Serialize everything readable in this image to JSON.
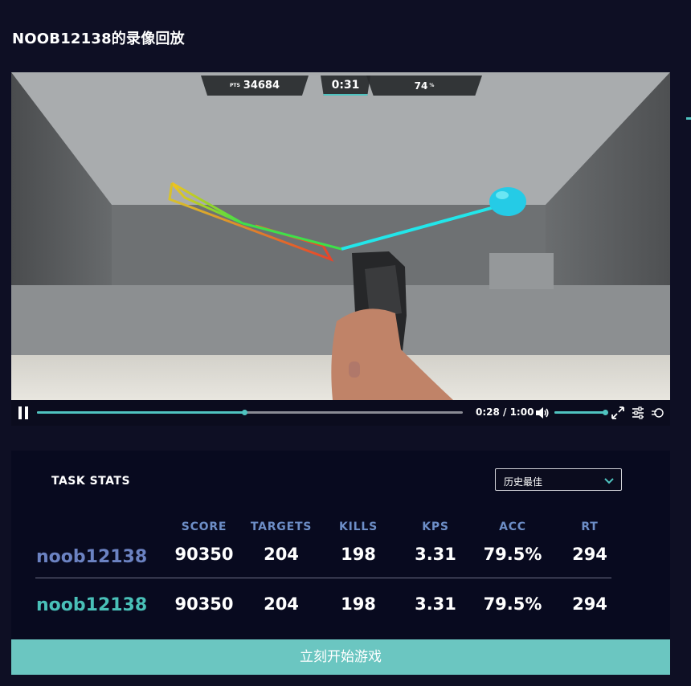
{
  "page": {
    "title": "NOOB12138的录像回放"
  },
  "hud": {
    "pts_label": "PTS",
    "points": "34684",
    "timer": "0:31",
    "accuracy": "74",
    "accuracy_unit": "%"
  },
  "player": {
    "time_text": "0:28 / 1:00",
    "progress": 0.486,
    "volume": 0.95,
    "icons": [
      "pause-icon",
      "volume-icon",
      "fullscreen-icon",
      "settings-sliders-icon",
      "mode-icon"
    ],
    "accent_color": "#4fc3c0"
  },
  "stats": {
    "title": "TASK STATS",
    "filter": {
      "selected": "历史最佳"
    },
    "columns": [
      "SCORE",
      "TARGETS",
      "KILLS",
      "KPS",
      "ACC",
      "RT"
    ],
    "rows": [
      {
        "name": "noob12138",
        "values": [
          "90350",
          "204",
          "198",
          "3.31",
          "79.5%",
          "294"
        ],
        "color": "#6b82c2"
      },
      {
        "name": "noob12138",
        "values": [
          "90350",
          "204",
          "198",
          "3.31",
          "79.5%",
          "294"
        ],
        "color": "#49c0b8"
      }
    ]
  },
  "start_button": {
    "label": "立刻开始游戏",
    "color": "#6bc6c1"
  }
}
